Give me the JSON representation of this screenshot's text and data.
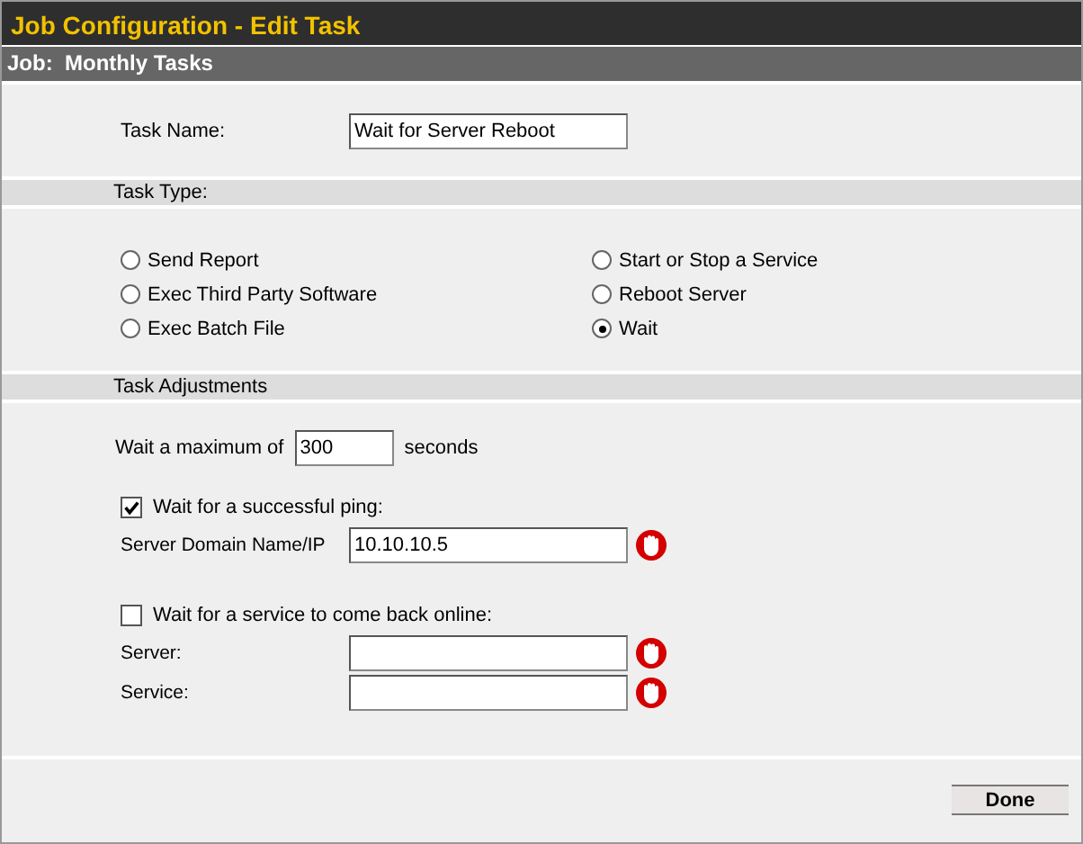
{
  "window": {
    "title": "Job Configuration - Edit Task"
  },
  "job_bar": {
    "text": "Job:  Monthly Tasks"
  },
  "task_name": {
    "label": "Task Name:",
    "value": "Wait for Server Reboot"
  },
  "task_type": {
    "heading": "Task Type:",
    "options": [
      {
        "label": "Send Report",
        "selected": false
      },
      {
        "label": "Exec Third Party Software",
        "selected": false
      },
      {
        "label": "Exec Batch File",
        "selected": false
      },
      {
        "label": "Start or Stop a Service",
        "selected": false
      },
      {
        "label": "Reboot Server",
        "selected": false
      },
      {
        "label": "Wait",
        "selected": true
      }
    ]
  },
  "task_adjustments": {
    "heading": "Task Adjustments",
    "wait_max": {
      "prefix": "Wait a maximum of",
      "value": "300",
      "suffix": "seconds"
    },
    "groups": [
      {
        "label": "Wait for a successful ping:",
        "checked": true,
        "fields": [
          {
            "label": "Server Domain Name/IP",
            "value": "10.10.10.5",
            "required": true
          }
        ]
      },
      {
        "label": "Wait for a service to come back online:",
        "checked": false,
        "fields": [
          {
            "label": "Server:",
            "required": true
          },
          {
            "label": "Service:",
            "required": true
          }
        ]
      }
    ]
  },
  "buttons": [
    {
      "label": "Done"
    }
  ]
}
